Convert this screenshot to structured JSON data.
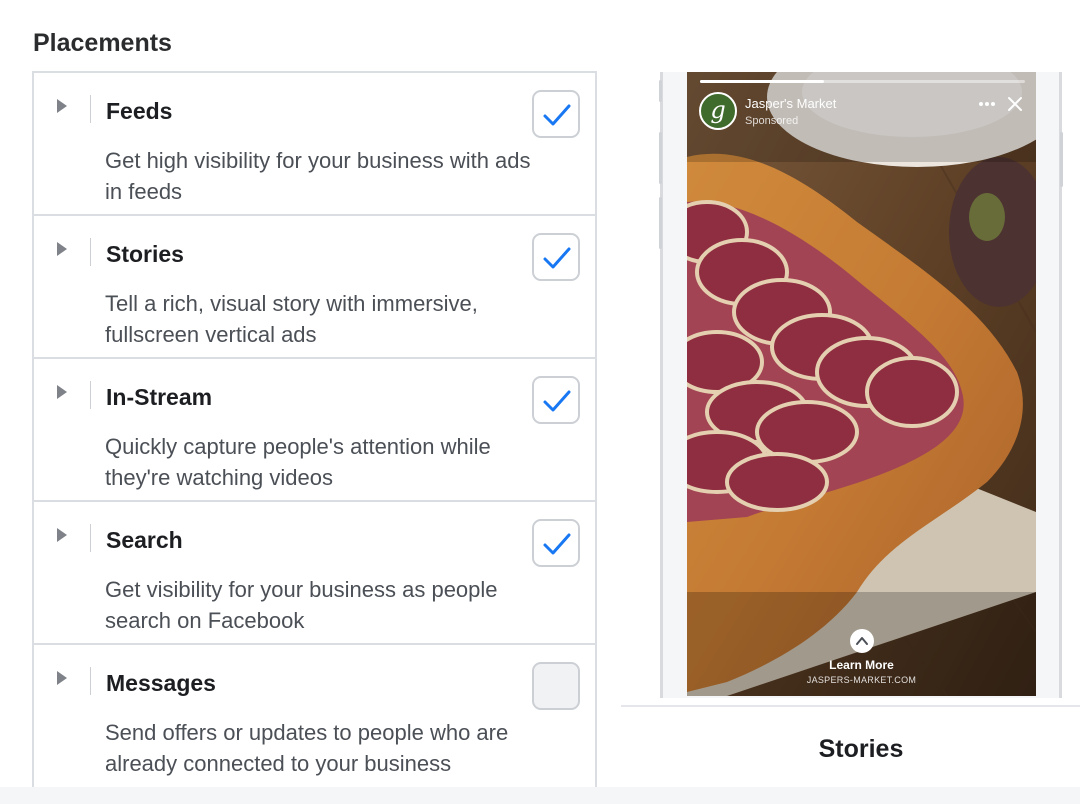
{
  "page": {
    "title": "Placements"
  },
  "placements": [
    {
      "title": "Feeds",
      "description": "Get high visibility for your business with ads in feeds",
      "checked": true
    },
    {
      "title": "Stories",
      "description": "Tell a rich, visual story with immersive, fullscreen vertical ads",
      "checked": true
    },
    {
      "title": "In-Stream",
      "description": "Quickly capture people's attention while they're watching videos",
      "checked": true
    },
    {
      "title": "Search",
      "description": "Get visibility for your business as people search on Facebook",
      "checked": true
    },
    {
      "title": "Messages",
      "description": "Send offers or updates to people who are already connected to your business",
      "checked": false
    }
  ],
  "preview": {
    "brand_name": "Jasper's Market",
    "sponsored_label": "Sponsored",
    "avatar_letter": "g",
    "progress": 0.38,
    "cta_label": "Learn More",
    "cta_url": "JASPERS-MARKET.COM",
    "caption": "Stories"
  },
  "colors": {
    "accent": "#1877f2",
    "border": "#dadde1",
    "text": "#1c1e21",
    "secondary_text": "#4b4f56"
  },
  "icons": {
    "expand": "triangle-right-icon",
    "check": "checkmark-icon",
    "more": "more-dots-icon",
    "close": "close-icon",
    "cta": "chevron-up-icon"
  }
}
